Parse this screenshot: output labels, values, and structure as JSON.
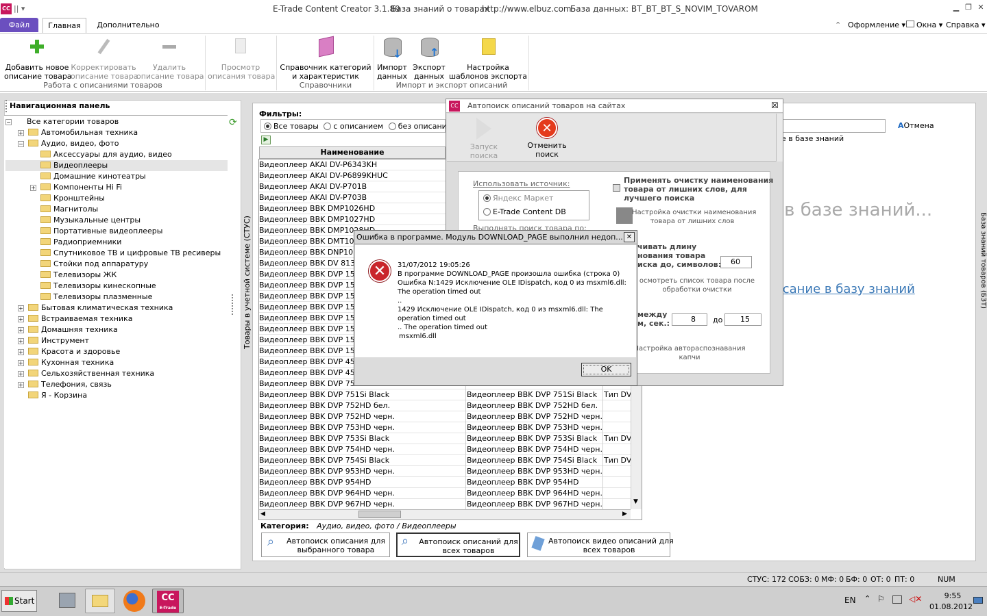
{
  "titlebar": {
    "app_name": "E-Trade Content Creator 3.1.89",
    "kb_label": "База знаний о товарах",
    "url": "http://www.elbuz.com",
    "db_label": "База данных: BT_BT_BT_S_NOVIM_TOVAROM",
    "app_icon": "CC"
  },
  "ribbon_tabs": {
    "file": "Файл",
    "home": "Главная",
    "extra": "Дополнительно"
  },
  "ribbon_right": {
    "design": "Оформление",
    "windows": "Окна",
    "help": "Справка"
  },
  "ribbon": {
    "add": "Добавить новое\nописание товара",
    "edit": "Корректировать\nописание товара",
    "delete": "Удалить\nописание товара",
    "view": "Просмотр\nописания товара",
    "catalog": "Справочник категорий\nи характеристик",
    "import": "Импорт\nданных",
    "export": "Экспорт\nданных",
    "templates": "Настройка\nшаблонов экспорта",
    "group1": "Работа с описаниями товаров",
    "group2": "Справочники",
    "group3": "Импорт и экспорт описаний"
  },
  "nav": {
    "title": "Навигационная панель",
    "side_label": "Товары в учетной системе (СТУС)",
    "tree": [
      {
        "label": "Все категории товаров",
        "level": 0,
        "exp": "−"
      },
      {
        "label": "Автомобильная техника",
        "level": 1,
        "exp": "+"
      },
      {
        "label": "Аудио, видео, фото",
        "level": 1,
        "exp": "−"
      },
      {
        "label": "Аксессуары для аудио, видео",
        "level": 2,
        "exp": ""
      },
      {
        "label": "Видеоплееры",
        "level": 2,
        "exp": "",
        "selected": true
      },
      {
        "label": "Домашние кинотеатры",
        "level": 2,
        "exp": ""
      },
      {
        "label": "Компоненты Hi Fi",
        "level": 2,
        "exp": "+"
      },
      {
        "label": "Кронштейны",
        "level": 2,
        "exp": ""
      },
      {
        "label": "Магнитолы",
        "level": 2,
        "exp": ""
      },
      {
        "label": "Музыкальные центры",
        "level": 2,
        "exp": ""
      },
      {
        "label": "Портативные видеоплееры",
        "level": 2,
        "exp": ""
      },
      {
        "label": "Радиоприемники",
        "level": 2,
        "exp": ""
      },
      {
        "label": "Спутниковое ТВ и цифровые ТВ ресиверы",
        "level": 2,
        "exp": ""
      },
      {
        "label": "Стойки под аппаратуру",
        "level": 2,
        "exp": ""
      },
      {
        "label": "Телевизоры ЖК",
        "level": 2,
        "exp": ""
      },
      {
        "label": "Телевизоры кинескопные",
        "level": 2,
        "exp": ""
      },
      {
        "label": "Телевизоры плазменные",
        "level": 2,
        "exp": ""
      },
      {
        "label": "Бытовая климатическая техника",
        "level": 1,
        "exp": "+"
      },
      {
        "label": "Встраиваемая техника",
        "level": 1,
        "exp": "+"
      },
      {
        "label": "Домашняя техника",
        "level": 1,
        "exp": "+"
      },
      {
        "label": "Инструмент",
        "level": 1,
        "exp": "+"
      },
      {
        "label": "Красота и здоровье",
        "level": 1,
        "exp": "+"
      },
      {
        "label": "Кухонная техника",
        "level": 1,
        "exp": "+"
      },
      {
        "label": "Сельхозяйственная техника",
        "level": 1,
        "exp": "+"
      },
      {
        "label": "Телефония, связь",
        "level": 1,
        "exp": "+"
      },
      {
        "label": "Я - Корзина",
        "level": 1,
        "exp": ""
      }
    ]
  },
  "filters": {
    "title": "Фильтры:",
    "all": "Все товары",
    "with": "с описанием",
    "without": "без описания"
  },
  "grid": {
    "header": "Наименование",
    "rows": [
      [
        "Видеоплеер AKAI DV-P6343KH",
        "",
        ""
      ],
      [
        "Видеоплеер AKAI DV-P6899KHUC",
        "",
        ""
      ],
      [
        "Видеоплеер AKAI DV-P701B",
        "",
        ""
      ],
      [
        "Видеоплеер AKAI DV-P703B",
        "",
        ""
      ],
      [
        "Видеоплеер BBK DMP1026HD",
        "",
        ""
      ],
      [
        "Видеоплеер BBK DMP1027HD",
        "",
        ""
      ],
      [
        "Видеоплеер BBK DMP1028HD",
        "",
        ""
      ],
      [
        "Видеоплеер BBK DMT1026H",
        "",
        ""
      ],
      [
        "Видеоплеер BBK DNP1031H",
        "",
        ""
      ],
      [
        "Видеоплеер BBK DV 813X се",
        "",
        ""
      ],
      [
        "Видеоплеер BBK DVP 155SI",
        "",
        ""
      ],
      [
        "Видеоплеер BBK DVP 155SI",
        "",
        ""
      ],
      [
        "Видеоплеер BBK DVP 156SI",
        "",
        ""
      ],
      [
        "Видеоплеер BBK DVP 157SI",
        "",
        ""
      ],
      [
        "Видеоплеер BBK DVP 157SI",
        "",
        ""
      ],
      [
        "Видеоплеер BBK DVP 158SI",
        "",
        ""
      ],
      [
        "Видеоплеер BBK DVP 158SI",
        "",
        ""
      ],
      [
        "Видеоплеер BBK DVP 158Si",
        "",
        ""
      ],
      [
        "Видеоплеер BBK DVP 457SI",
        "",
        ""
      ],
      [
        "Видеоплеер BBK DVP 458SI",
        "",
        ""
      ],
      [
        "Видеоплеер BBK DVP 751HD",
        "",
        ""
      ],
      [
        "Видеоплеер BBK DVP 751Si Black",
        "Видеоплеер BBK DVP 751Si Black",
        "Тип DVD"
      ],
      [
        "Видеоплеер BBK DVP 752HD бел.",
        "Видеоплеер BBK DVP 752HD бел.",
        ""
      ],
      [
        "Видеоплеер BBK DVP 752HD черн.",
        "Видеоплеер BBK DVP 752HD черн.",
        ""
      ],
      [
        "Видеоплеер BBK DVP 753HD черн.",
        "Видеоплеер BBK DVP 753HD черн.",
        ""
      ],
      [
        "Видеоплеер BBK DVP 753Si Black",
        "Видеоплеер BBK DVP 753Si Black",
        "Тип DVD"
      ],
      [
        "Видеоплеер BBK DVP 754HD черн.",
        "Видеоплеер BBK DVP 754HD черн.",
        ""
      ],
      [
        "Видеоплеер BBK DVP 754Si Black",
        "Видеоплеер BBK DVP 754Si Black",
        "Тип DVD"
      ],
      [
        "Видеоплеер BBK DVP 953HD черн.",
        "Видеоплеер BBK DVP 953HD черн.",
        ""
      ],
      [
        "Видеоплеер BBK DVP 954HD",
        "Видеоплеер BBK DVP 954HD",
        ""
      ],
      [
        "Видеоплеер BBK DVP 964HD черн.",
        "Видеоплеер BBK DVP 964HD черн.",
        ""
      ],
      [
        "Видеоплеер BBK DVP 967HD черн.",
        "Видеоплеер BBK DVP 967HD черн.",
        ""
      ]
    ]
  },
  "category": {
    "label": "Категория:",
    "value": "Аудио, видео, фото / Видеоплееры"
  },
  "bottom_buttons": {
    "b1": "Автопоиск описания для\nвыбранного товара",
    "b2": "Автопоиск описаний для\nвсех товаров",
    "b3": "Автопоиск видео описаний для\nвсех товаров"
  },
  "right_area": {
    "cancel": "Отмена",
    "in_kb": "е в базе знаний",
    "big_text": "ых в базе знаний...",
    "link": "исание в базу знаний",
    "side_label": "База знаний товаров (БЗТ)"
  },
  "autosearch": {
    "title": "Автопоиск описаний товаров на сайтах",
    "start": "Запуск поиска",
    "cancel": "Отменить поиск",
    "use_source": "Использовать источник:",
    "src1": "Яндекс Маркет",
    "src2": "E-Trade Content DB",
    "search_by": "Выполнять поиск товара по:",
    "clean_check": "Применять очистку наименования\nтовара от лишних слов, для\nлучшего поиска",
    "clean_settings": "Настройка очистки наименования\nтовара от лишних слов",
    "limit_label": "чивать длину\nнования товара\nиска до, символов:",
    "limit_value": "60",
    "view_list": "осмотреть список товара после\nобработки очистки",
    "delay_label": "между\nм, сек.:",
    "delay_from": "8",
    "delay_to_label": "до",
    "delay_to": "15",
    "captcha": "Настройка автораспознавания\nкапчи"
  },
  "error": {
    "title": "Ошибка в программе. Модуль DOWNLOAD_PAGE выполнил недоп...",
    "line1": "31/07/2012 19:05:26",
    "line2": "В программе DOWNLOAD_PAGE произошла ошибка (строка 0)",
    "line3": "Ошибка N:1429 Исключение OLE IDispatch, код 0 из msxml6.dll:",
    "line4": "The operation timed out",
    "line5": "..",
    "line6": "1429 Исключение OLE IDispatch, код 0 из msxml6.dll: The",
    "line7": "operation timed out",
    "line8": ".. The operation timed out",
    "line9": "msxml6.dll",
    "ok": "OK"
  },
  "status": {
    "stus": "СТУС: 172",
    "sobz": "СОБЗ: 0",
    "mf": "МФ: 0",
    "bf": "БФ: 0",
    "ot": "ОТ: 0",
    "pt": "ПТ: 0",
    "num": "NUM"
  },
  "taskbar": {
    "start": "Start",
    "lang": "EN",
    "time": "9:55",
    "date": "01.08.2012",
    "app_label": "E-Trade"
  }
}
